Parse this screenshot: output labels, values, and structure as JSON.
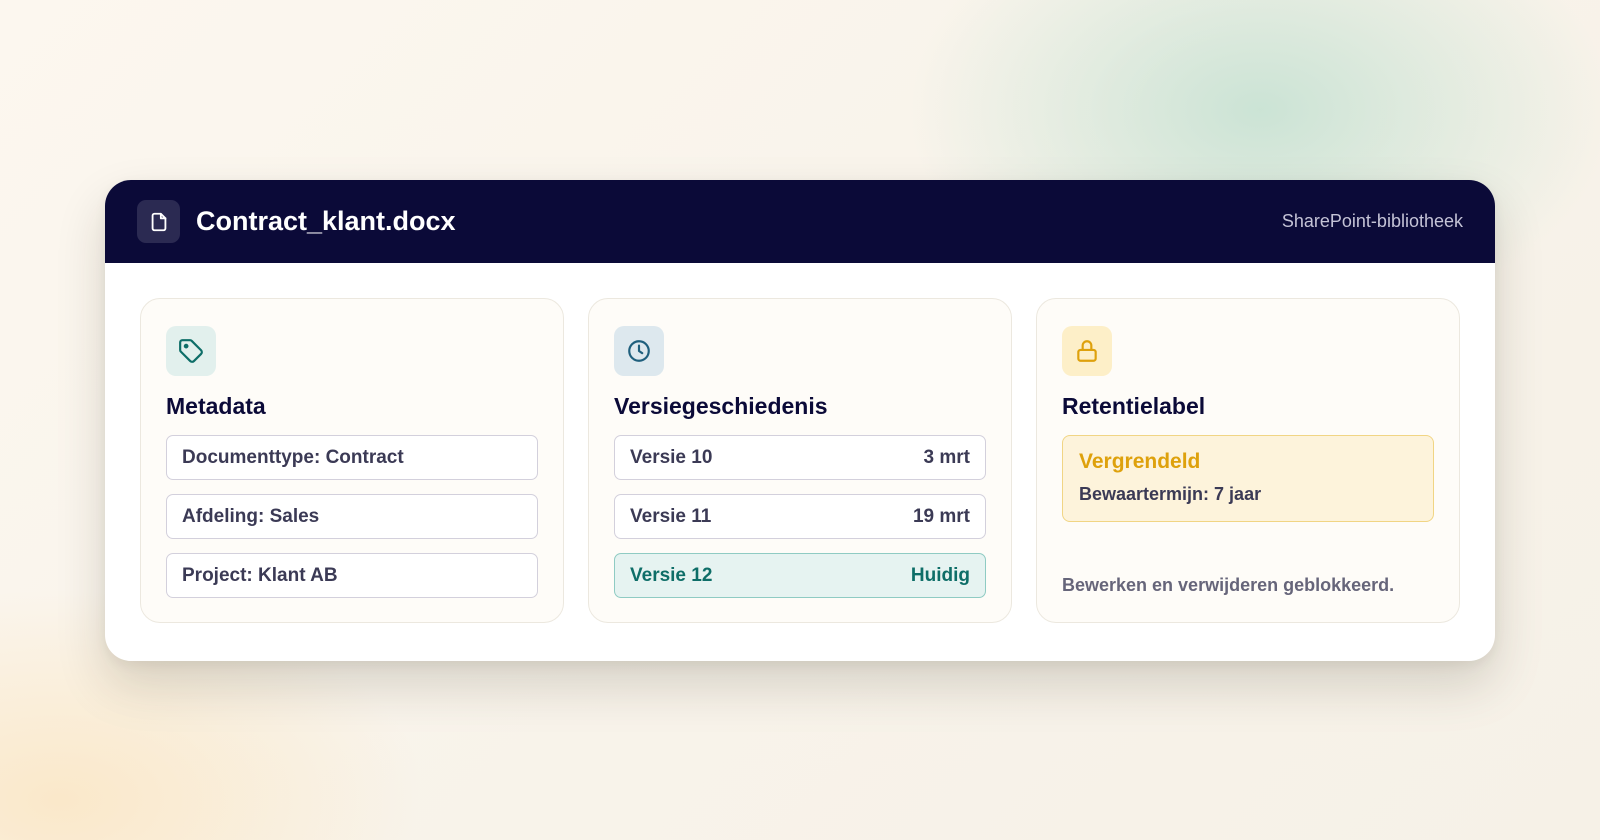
{
  "header": {
    "file_icon": "document-icon",
    "title": "Contract_klant.docx",
    "library": "SharePoint-bibliotheek"
  },
  "panels": {
    "metadata": {
      "icon": "tag-icon",
      "title": "Metadata",
      "items": [
        {
          "label": "Documenttype: Contract"
        },
        {
          "label": "Afdeling: Sales"
        },
        {
          "label": "Project: Klant AB"
        }
      ]
    },
    "versions": {
      "icon": "clock-icon",
      "title": "Versiegeschiedenis",
      "items": [
        {
          "label": "Versie 10",
          "date": "3 mrt",
          "current": false
        },
        {
          "label": "Versie 11",
          "date": "19 mrt",
          "current": false
        },
        {
          "label": "Versie 12",
          "date": "Huidig",
          "current": true
        }
      ]
    },
    "retention": {
      "icon": "lock-icon",
      "title": "Retentielabel",
      "status": "Vergrendeld",
      "period": "Bewaartermijn: 7 jaar",
      "note": "Bewerken en verwijderen geblokkeerd."
    }
  },
  "colors": {
    "header_bg": "#0b0a38",
    "teal_accent": "#0e6e68",
    "amber_accent": "#dea10c",
    "amber_bg": "#fdf3db"
  }
}
